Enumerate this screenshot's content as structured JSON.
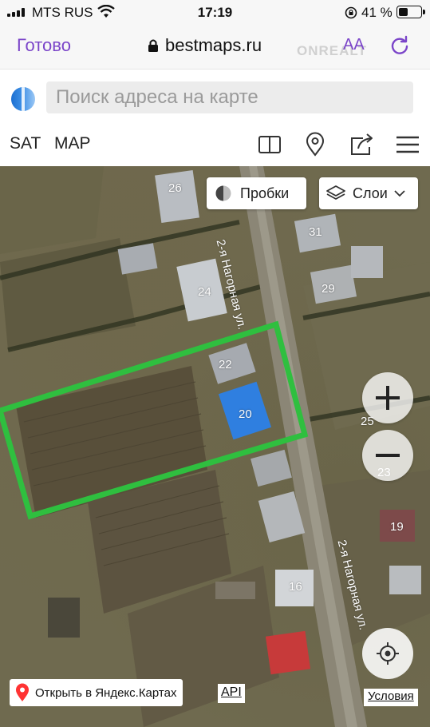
{
  "status_bar": {
    "carrier": "MTS RUS",
    "time": "17:19",
    "battery_percent": "41 %",
    "battery_level": 0.41
  },
  "browser": {
    "done_label": "Готово",
    "url": "bestmaps.ru",
    "text_size_label": "AA",
    "watermark": "ONREALT"
  },
  "search": {
    "placeholder": "Поиск адреса на карте"
  },
  "toolbar": {
    "sat_label": "SAT",
    "map_label": "MAP"
  },
  "map": {
    "traffic_button": "Пробки",
    "layers_button": "Слои",
    "street_name": "2-я Нагорная ул.",
    "house_numbers": [
      "26",
      "31",
      "24",
      "29",
      "22",
      "20",
      "25",
      "23",
      "19",
      "16"
    ],
    "highlight_color": "#2fbf3f",
    "open_in_yandex": "Открыть в Яндекс.Картах",
    "api_label": "API",
    "terms_label": "Условия"
  }
}
